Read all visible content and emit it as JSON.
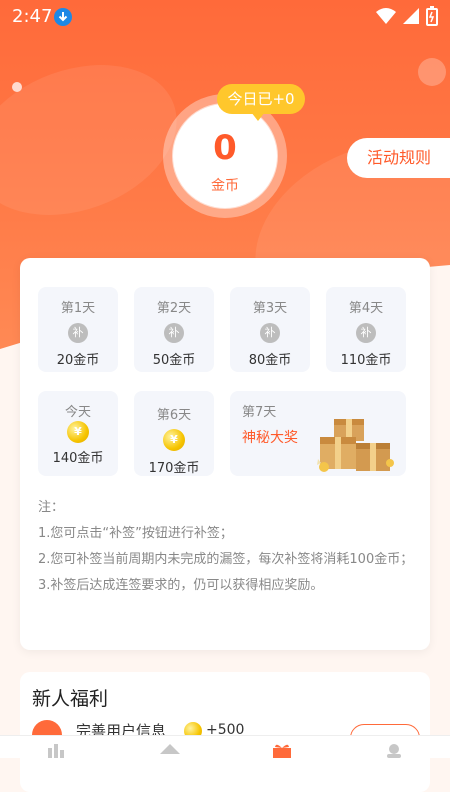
{
  "status": {
    "time": "2:47"
  },
  "header": {
    "today_badge": "今日已+0",
    "coins_value": "0",
    "coins_unit": "金币",
    "rules_button": "活动规则"
  },
  "days": [
    {
      "label": "第1天",
      "reward": "20金币",
      "state": "missed",
      "icon": "bu-icon",
      "icon_text": "补"
    },
    {
      "label": "第2天",
      "reward": "50金币",
      "state": "missed",
      "icon": "bu-icon",
      "icon_text": "补"
    },
    {
      "label": "第3天",
      "reward": "80金币",
      "state": "missed",
      "icon": "bu-icon",
      "icon_text": "补"
    },
    {
      "label": "第4天",
      "reward": "110金币",
      "state": "missed",
      "icon": "bu-icon",
      "icon_text": "补"
    },
    {
      "label": "今天",
      "reward": "140金币",
      "state": "today",
      "icon": "coin-icon",
      "icon_text": "¥"
    },
    {
      "label": "第6天",
      "reward": "170金币",
      "state": "future",
      "icon": "coin-icon",
      "icon_text": "¥"
    },
    {
      "label": "第7天",
      "reward": "神秘大奖",
      "state": "future",
      "icon": "gift-icon"
    }
  ],
  "notes": {
    "title": "注：",
    "items": [
      "1.您可点击“补签”按钮进行补签；",
      "2.您可补签当前周期内未完成的漏签，每次补签将消耗100金币；",
      "3.补签后达成连签要求的，仍可以获得相应奖励。"
    ]
  },
  "welfare": {
    "title": "新人福利",
    "task_name": "完善用户信息",
    "task_reward": "+500"
  },
  "colors": {
    "accent": "#ff6a3a",
    "coin": "#f6c400",
    "badge": "#ffc72c"
  }
}
